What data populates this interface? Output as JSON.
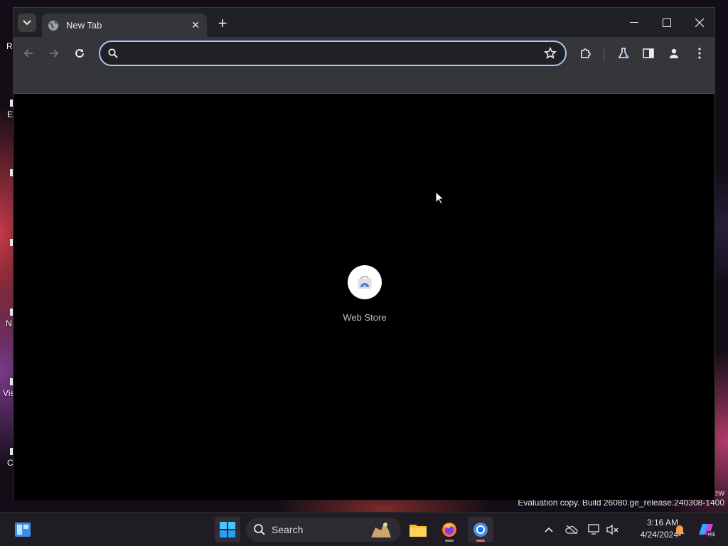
{
  "desktop": {
    "icons": [
      "R",
      "E",
      "",
      "",
      "N",
      "Vis",
      "C"
    ],
    "watermark_top": "ew",
    "watermark": "Evaluation copy. Build 26080.ge_release.240308-1400"
  },
  "browser": {
    "tab": {
      "title": "New Tab",
      "icon": "globe-icon"
    },
    "omnibox": {
      "value": "",
      "placeholder": ""
    },
    "shortcuts": [
      {
        "label": "Web Store",
        "icon": "web-store-icon"
      }
    ]
  },
  "taskbar": {
    "search_label": "Search",
    "clock": {
      "time": "3:16 AM",
      "date": "4/24/2024"
    }
  },
  "colors": {
    "accent": "#a8c7fa",
    "toolbar": "#35363a",
    "tabstrip": "#202124",
    "taskbar": "#1f1c24"
  }
}
